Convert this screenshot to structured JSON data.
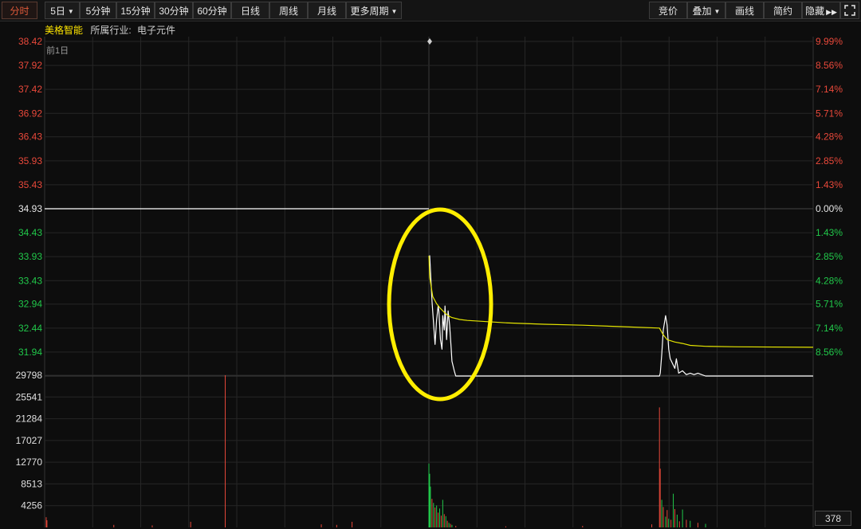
{
  "toolbar": {
    "left": [
      {
        "label": "分时",
        "active": true,
        "dropdown": false
      },
      {
        "label": "5日",
        "active": false,
        "dropdown": true
      },
      {
        "label": "5分钟",
        "active": false,
        "dropdown": false
      },
      {
        "label": "15分钟",
        "active": false,
        "dropdown": false
      },
      {
        "label": "30分钟",
        "active": false,
        "dropdown": false
      },
      {
        "label": "60分钟",
        "active": false,
        "dropdown": false
      },
      {
        "label": "日线",
        "active": false,
        "dropdown": false
      },
      {
        "label": "周线",
        "active": false,
        "dropdown": false
      },
      {
        "label": "月线",
        "active": false,
        "dropdown": false
      },
      {
        "label": "更多周期",
        "active": false,
        "dropdown": true
      }
    ],
    "right": [
      {
        "label": "竞价",
        "dropdown": false
      },
      {
        "label": "叠加",
        "dropdown": true
      },
      {
        "label": "画线",
        "dropdown": false
      },
      {
        "label": "简约",
        "dropdown": false
      },
      {
        "label": "隐藏",
        "dropdown": false,
        "suffix": "▶▶"
      },
      {
        "label": "",
        "icon": "fullscreen-icon"
      }
    ]
  },
  "info": {
    "stock_name": "美格智能",
    "industry_label": "所属行业:",
    "industry": "电子元件"
  },
  "prev_day_label": "前1日",
  "colors": {
    "up": "#e8483a",
    "down": "#21c84a",
    "flat": "#e6e6e6",
    "price_line": "#ffffff",
    "avg_line": "#e4e400",
    "annotation": "#ffee00",
    "grid": "#262626"
  },
  "chart_data": {
    "type": "line",
    "title": "",
    "price_axis": {
      "labels": [
        "38.42",
        "37.92",
        "37.42",
        "36.92",
        "36.43",
        "35.93",
        "35.43",
        "34.93",
        "34.43",
        "33.93",
        "33.43",
        "32.94",
        "32.44",
        "31.94"
      ],
      "reference_price": 34.93,
      "min": 31.44,
      "max": 38.42
    },
    "pct_axis": {
      "labels": [
        "9.99%",
        "8.56%",
        "7.14%",
        "5.71%",
        "4.28%",
        "2.85%",
        "1.43%",
        "0.00%",
        "1.43%",
        "2.85%",
        "4.28%",
        "5.71%",
        "7.14%",
        "8.56%"
      ]
    },
    "volume_axis": {
      "labels": [
        "29798",
        "25541",
        "21284",
        "17027",
        "12770",
        "8513",
        "4256"
      ],
      "max": 29798
    },
    "series": [
      {
        "key": "prev_day_price",
        "x": [
          0,
          0.5
        ],
        "values": [
          34.93,
          34.93
        ]
      },
      {
        "key": "price",
        "x": [
          0.5,
          0.501,
          0.504,
          0.508,
          0.51,
          0.512,
          0.513,
          0.515,
          0.517,
          0.518,
          0.52,
          0.521,
          0.523,
          0.525,
          0.527,
          0.529,
          0.53,
          0.533,
          0.535,
          0.55,
          0.6,
          0.65,
          0.7,
          0.75,
          0.8,
          0.8,
          0.801,
          0.803,
          0.805,
          0.808,
          0.81,
          0.812,
          0.814,
          0.817,
          0.82,
          0.822,
          0.825,
          0.83,
          0.835,
          0.84,
          0.845,
          0.85,
          0.86,
          1.0
        ],
        "values": [
          33.9,
          33.95,
          33.0,
          32.1,
          32.6,
          32.9,
          32.8,
          32.2,
          32.0,
          32.7,
          32.4,
          32.9,
          32.2,
          32.8,
          32.5,
          32.0,
          31.75,
          31.55,
          31.44,
          31.44,
          31.44,
          31.44,
          31.44,
          31.44,
          31.44,
          31.44,
          31.5,
          31.9,
          32.4,
          32.7,
          32.5,
          32.0,
          31.8,
          31.7,
          31.6,
          31.8,
          31.5,
          31.55,
          31.47,
          31.5,
          31.47,
          31.5,
          31.44,
          31.44
        ]
      },
      {
        "key": "avg_price",
        "x": [
          0.5,
          0.501,
          0.505,
          0.51,
          0.515,
          0.52,
          0.525,
          0.53,
          0.54,
          0.55,
          0.6,
          0.65,
          0.7,
          0.75,
          0.8,
          0.8,
          0.805,
          0.81,
          0.82,
          0.83,
          0.84,
          0.86,
          0.9,
          1.0
        ],
        "values": [
          33.95,
          33.5,
          33.1,
          32.95,
          32.85,
          32.77,
          32.7,
          32.66,
          32.62,
          32.6,
          32.55,
          32.52,
          32.5,
          32.47,
          32.44,
          32.44,
          32.3,
          32.2,
          32.15,
          32.12,
          32.08,
          32.06,
          32.05,
          32.04
        ]
      }
    ],
    "volume": {
      "x": [
        0.002,
        0.003,
        0.09,
        0.14,
        0.19,
        0.235,
        0.36,
        0.38,
        0.4,
        0.5,
        0.501,
        0.502,
        0.504,
        0.506,
        0.508,
        0.51,
        0.512,
        0.514,
        0.516,
        0.518,
        0.52,
        0.522,
        0.524,
        0.526,
        0.528,
        0.53,
        0.535,
        0.6,
        0.7,
        0.79,
        0.8,
        0.801,
        0.803,
        0.805,
        0.808,
        0.81,
        0.812,
        0.815,
        0.818,
        0.82,
        0.823,
        0.826,
        0.83,
        0.835,
        0.84,
        0.85,
        0.86
      ],
      "values": [
        2000,
        1400,
        500,
        400,
        1100,
        29798,
        600,
        500,
        1100,
        12500,
        10500,
        8000,
        5600,
        4800,
        3900,
        4300,
        2900,
        3700,
        2300,
        5400,
        2600,
        2200,
        1300,
        900,
        700,
        500,
        300,
        200,
        300,
        600,
        23500,
        11500,
        5400,
        4000,
        2100,
        3400,
        1700,
        1500,
        6600,
        3600,
        2500,
        1200,
        3500,
        1500,
        1300,
        900,
        700
      ],
      "colors": [
        "up",
        "up",
        "up",
        "up",
        "up",
        "up",
        "up",
        "up",
        "up",
        "down",
        "down",
        "down",
        "up",
        "down",
        "up",
        "down",
        "up",
        "down",
        "up",
        "down",
        "up",
        "down",
        "up",
        "down",
        "up",
        "down",
        "up",
        "up",
        "up",
        "up",
        "up",
        "up",
        "down",
        "up",
        "down",
        "up",
        "down",
        "up",
        "down",
        "up",
        "down",
        "up",
        "down",
        "up",
        "down",
        "up",
        "down"
      ]
    }
  },
  "volume_badge": "378"
}
